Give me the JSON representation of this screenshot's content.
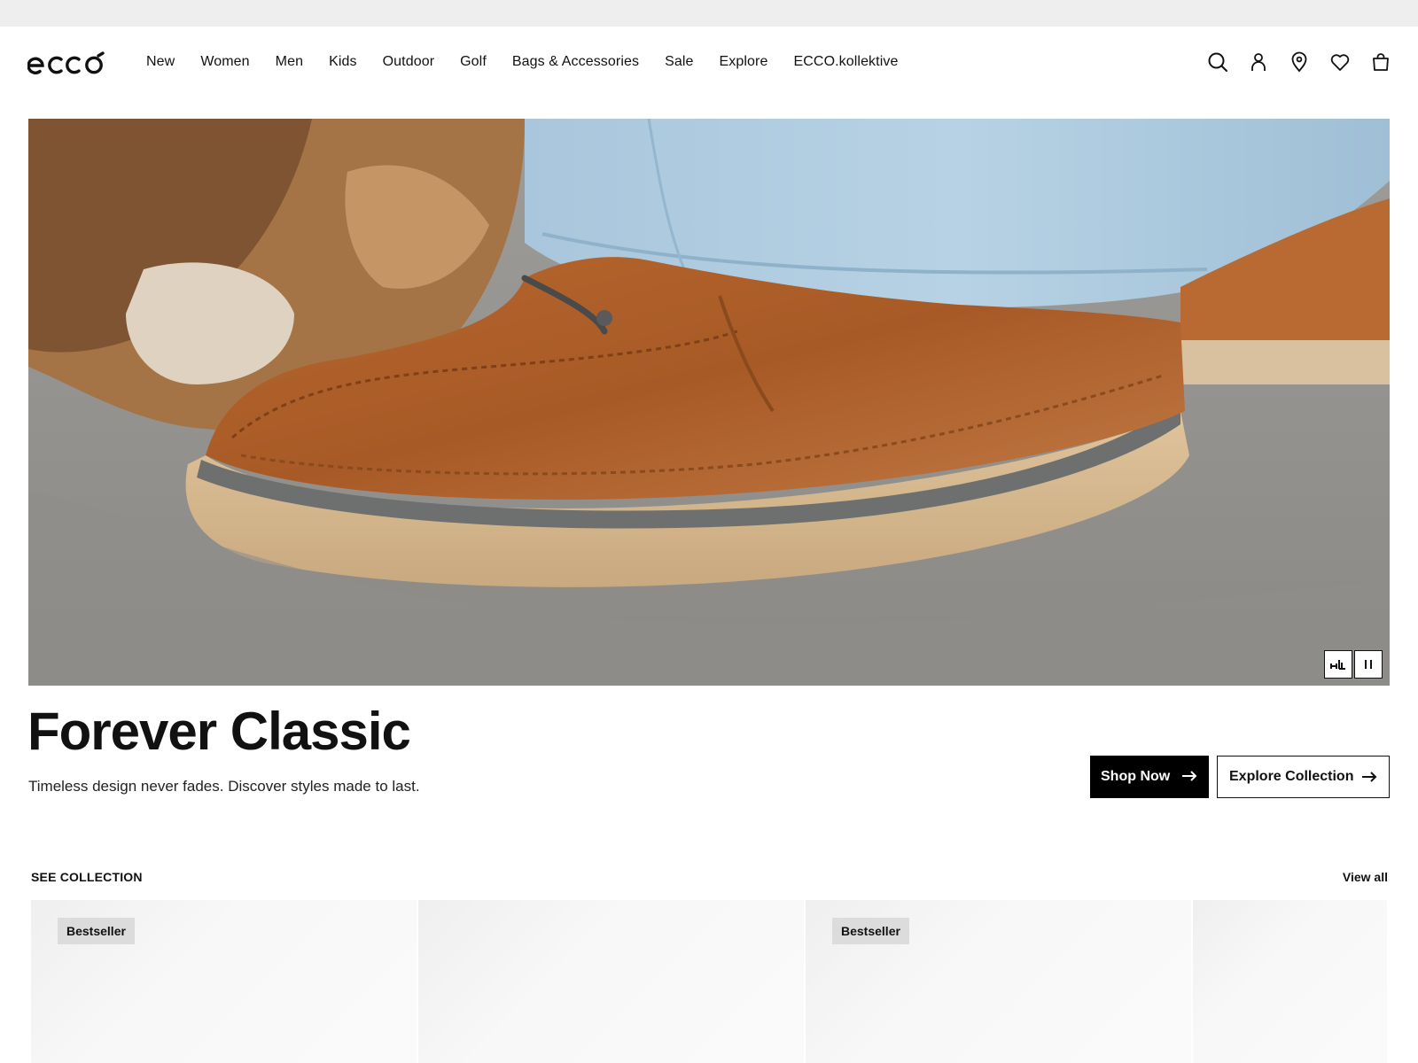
{
  "brand": {
    "name": "ecco"
  },
  "nav": {
    "items": [
      {
        "label": "New"
      },
      {
        "label": "Women"
      },
      {
        "label": "Men"
      },
      {
        "label": "Kids"
      },
      {
        "label": "Outdoor"
      },
      {
        "label": "Golf"
      },
      {
        "label": "Bags & Accessories"
      },
      {
        "label": "Sale"
      },
      {
        "label": "Explore"
      },
      {
        "label": "ECCO.kollektive"
      }
    ]
  },
  "header_icons": [
    "search-icon",
    "account-icon",
    "store-locator-icon",
    "wishlist-icon",
    "bag-icon"
  ],
  "hero": {
    "title": "Forever Classic",
    "subtitle": "Timeless design never fades. Discover styles made to last.",
    "primary_cta": "Shop Now",
    "secondary_cta": "Explore Collection",
    "video_controls": [
      "audio-description-icon",
      "pause-icon"
    ]
  },
  "collection": {
    "heading": "SEE COLLECTION",
    "view_all": "View all",
    "cards": [
      {
        "badge": "Bestseller"
      },
      {
        "badge": ""
      },
      {
        "badge": "Bestseller"
      },
      {
        "badge": ""
      }
    ]
  },
  "colors": {
    "primary_button": "#000000",
    "badge_bg": "#dcdcdc",
    "top_strip": "#eeeeee"
  }
}
